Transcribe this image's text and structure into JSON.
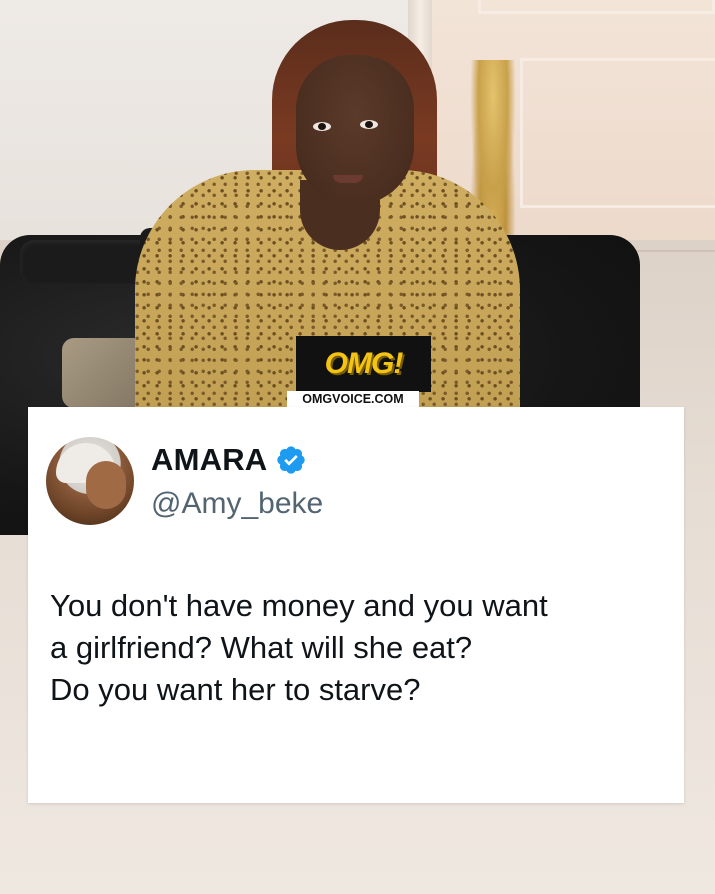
{
  "watermark": {
    "logo_text": "OMG!",
    "site_text": "OMGVOICE.COM"
  },
  "tweet": {
    "display_name": "AMARA",
    "verified": true,
    "handle": "@Amy_beke",
    "text_lines": [
      "You don't have money and you want",
      "a girlfriend? What will she eat?",
      "Do you want her to starve?"
    ]
  },
  "colors": {
    "omg_yellow": "#f3c316",
    "verified_blue": "#1d9bf0",
    "tweet_text": "#0f1419",
    "handle_gray": "#536471"
  },
  "icons": {
    "verified": "verified-badge-icon",
    "avatar": "profile-photo"
  }
}
